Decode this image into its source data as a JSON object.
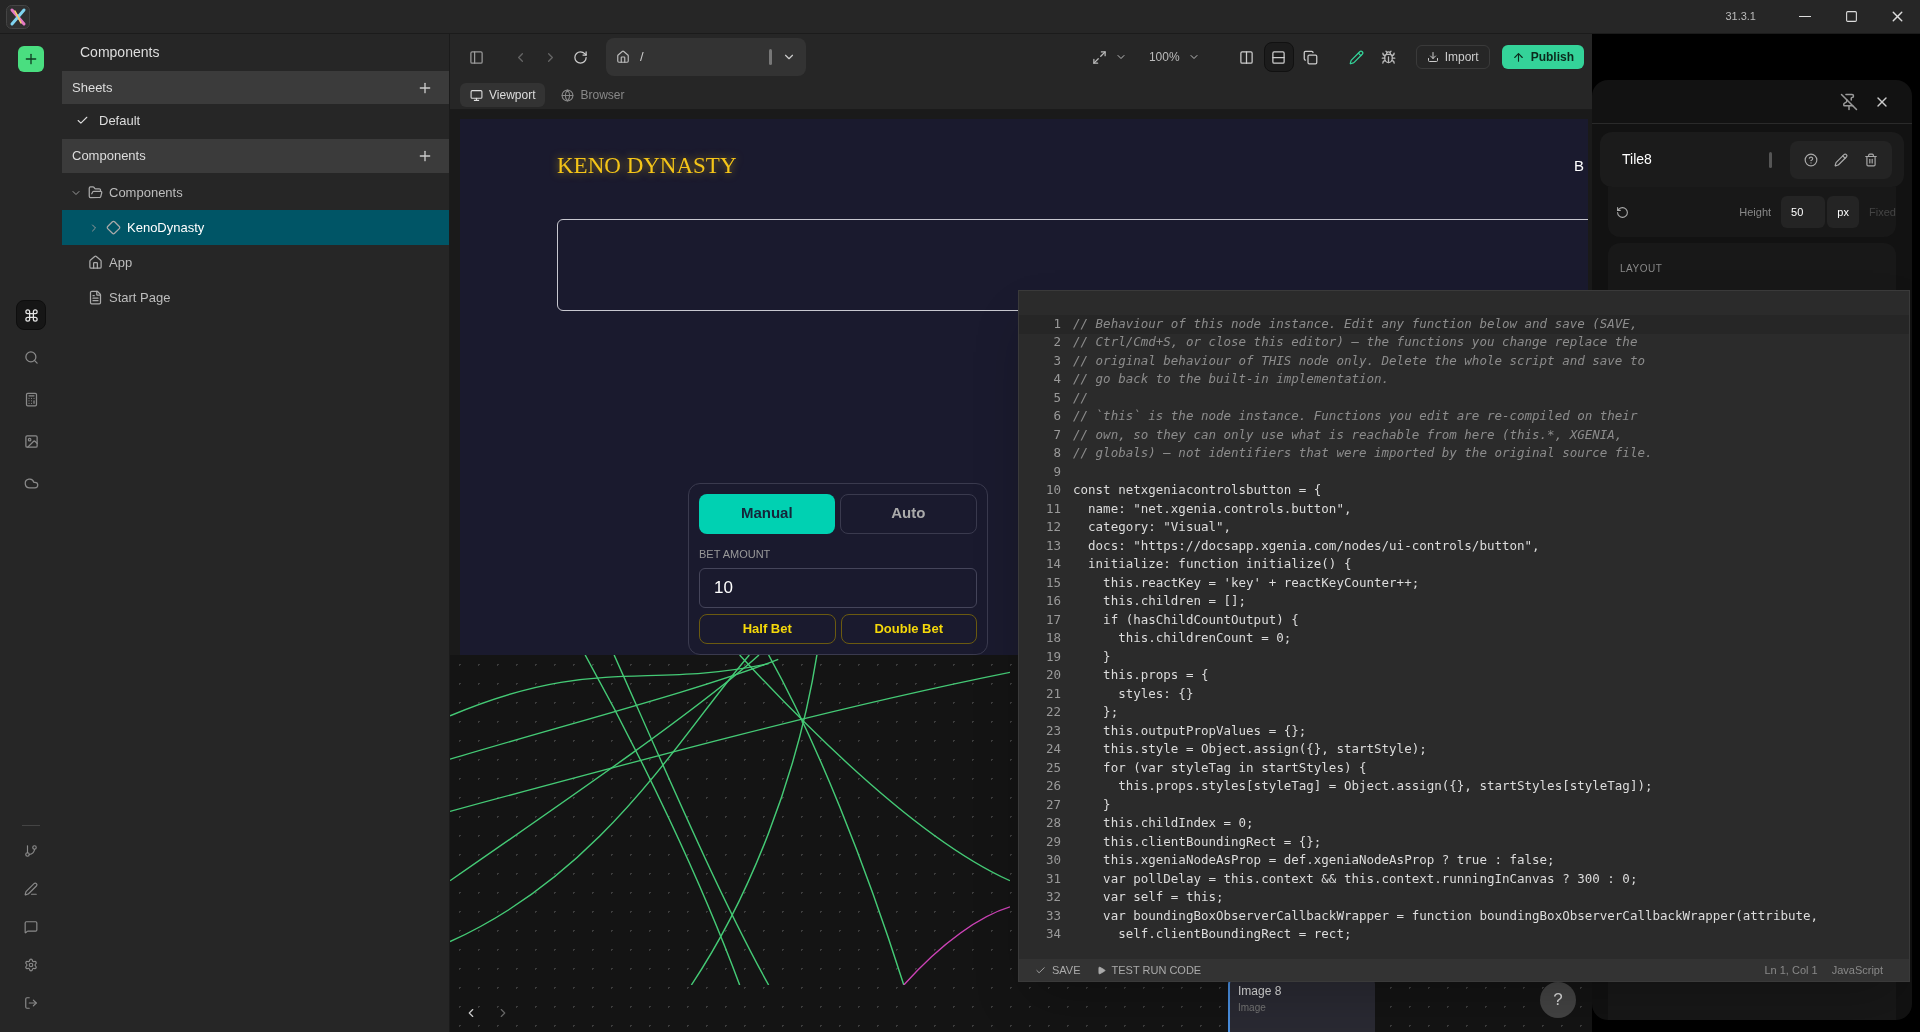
{
  "title_bar": {
    "version": "31.3.1"
  },
  "rail": {
    "items": [
      {
        "kind": "components",
        "selected": true
      },
      {
        "kind": "search",
        "selected": false
      },
      {
        "kind": "math",
        "selected": false
      },
      {
        "kind": "image",
        "selected": false
      },
      {
        "kind": "cloud",
        "selected": false
      }
    ],
    "bottom_items": [
      {
        "kind": "branch"
      },
      {
        "kind": "pen"
      },
      {
        "kind": "chat"
      },
      {
        "kind": "settings"
      },
      {
        "kind": "exit"
      }
    ]
  },
  "sidebar": {
    "title": "Components",
    "sheets": {
      "title": "Sheets",
      "items": [
        {
          "label": "Default",
          "checked": true
        }
      ]
    },
    "components": {
      "title": "Components",
      "tree": [
        {
          "label": "Components",
          "kind": "folder",
          "expanded": true,
          "selected": false,
          "children": [
            {
              "label": "KenoDynasty",
              "kind": "component",
              "expanded": false,
              "selected": true
            }
          ]
        },
        {
          "label": "App",
          "kind": "home",
          "selected": false
        },
        {
          "label": "Start Page",
          "kind": "page",
          "selected": false
        }
      ]
    }
  },
  "toolbar": {
    "address": "/",
    "zoom": "100%",
    "layout_modes": [
      {
        "kind": "columns",
        "selected": false
      },
      {
        "kind": "rows",
        "selected": true
      },
      {
        "kind": "windows",
        "selected": false
      }
    ],
    "import": "Import",
    "publish": "Publish",
    "tabs": [
      {
        "label": "Viewport",
        "kind": "viewport",
        "selected": true
      },
      {
        "label": "Browser",
        "kind": "browser",
        "selected": false
      }
    ]
  },
  "viewport": {
    "title": "KENO DYNASTY",
    "edge_text": "B",
    "bet_label": "BET AMOUNT",
    "bet_value": "10",
    "mode_tabs": [
      {
        "label": "Manual",
        "selected": true
      },
      {
        "label": "Auto",
        "selected": false
      }
    ],
    "bet_buttons": [
      "Half Bet",
      "Double Bet"
    ]
  },
  "node_canvas": {
    "node": {
      "title": "Image 8",
      "type": "Image"
    },
    "help": "?"
  },
  "properties": {
    "title": "Tile8",
    "height": {
      "label": "Height",
      "value": "50",
      "unit": "px",
      "mode": "Fixed"
    },
    "section": "LAYOUT"
  },
  "editor": {
    "lines": [
      {
        "n": "1",
        "kind": "comment",
        "text": "// Behaviour of this node instance. Edit any function below and save (SAVE,"
      },
      {
        "n": "2",
        "kind": "comment",
        "text": "// Ctrl/Cmd+S, or close this editor) — the functions you change replace the"
      },
      {
        "n": "3",
        "kind": "comment",
        "text": "// original behaviour of THIS node only. Delete the whole script and save to"
      },
      {
        "n": "4",
        "kind": "comment",
        "text": "// go back to the built-in implementation."
      },
      {
        "n": "5",
        "kind": "comment",
        "text": "//"
      },
      {
        "n": "6",
        "kind": "comment",
        "text": "// `this` is the node instance. Functions you edit are re-compiled on their"
      },
      {
        "n": "7",
        "kind": "comment",
        "text": "// own, so they can only use what is reachable from here (this.*, XGENIA,"
      },
      {
        "n": "8",
        "kind": "comment",
        "text": "// globals) — not identifiers that were imported by the original source file."
      },
      {
        "n": "9"
      },
      {
        "n": "10",
        "kind": "code",
        "text": "const netxgeniacontrolsbutton = {"
      },
      {
        "n": "11",
        "kind": "code",
        "text": "  name: \"net.xgenia.controls.button\","
      },
      {
        "n": "12",
        "kind": "code",
        "text": "  category: \"Visual\","
      },
      {
        "n": "13",
        "kind": "code",
        "text": "  docs: \"https://docsapp.xgenia.com/nodes/ui-controls/button\","
      },
      {
        "n": "14",
        "kind": "code",
        "text": "  initialize: function initialize() {"
      },
      {
        "n": "15",
        "kind": "code",
        "text": "    this.reactKey = 'key' + reactKeyCounter++;"
      },
      {
        "n": "16",
        "kind": "code",
        "text": "    this.children = [];"
      },
      {
        "n": "17",
        "kind": "code",
        "text": "    if (hasChildCountOutput) {"
      },
      {
        "n": "18",
        "kind": "code",
        "text": "      this.childrenCount = 0;"
      },
      {
        "n": "19",
        "kind": "code",
        "text": "    }"
      },
      {
        "n": "20",
        "kind": "code",
        "text": "    this.props = {"
      },
      {
        "n": "21",
        "kind": "code",
        "text": "      styles: {}"
      },
      {
        "n": "22",
        "kind": "code",
        "text": "    };"
      },
      {
        "n": "23",
        "kind": "code",
        "text": "    this.outputPropValues = {};"
      },
      {
        "n": "24",
        "kind": "code",
        "text": "    this.style = Object.assign({}, startStyle);"
      },
      {
        "n": "25",
        "kind": "code",
        "text": "    for (var styleTag in startStyles) {"
      },
      {
        "n": "26",
        "kind": "code",
        "text": "      this.props.styles[styleTag] = Object.assign({}, startStyles[styleTag]);"
      },
      {
        "n": "27",
        "kind": "code",
        "text": "    }"
      },
      {
        "n": "28",
        "kind": "code",
        "text": "    this.childIndex = 0;"
      },
      {
        "n": "29",
        "kind": "code",
        "text": "    this.clientBoundingRect = {};"
      },
      {
        "n": "30",
        "kind": "code",
        "text": "    this.xgeniaNodeAsProp = def.xgeniaNodeAsProp ? true : false;"
      },
      {
        "n": "31",
        "kind": "code",
        "text": "    var pollDelay = this.context && this.context.runningInCanvas ? 300 : 0;"
      },
      {
        "n": "32",
        "kind": "code",
        "text": "    var self = this;"
      },
      {
        "n": "33",
        "kind": "code",
        "text": "    var boundingBoxObserverCallbackWrapper = function boundingBoxObserverCallbackWrapper(attribute,"
      },
      {
        "n": "34",
        "kind": "code",
        "text": "      self.clientBoundingRect = rect;"
      }
    ],
    "save": "SAVE",
    "test_run": "TEST RUN CODE",
    "cursor": "Ln 1, Col 1",
    "language": "JavaScript"
  }
}
